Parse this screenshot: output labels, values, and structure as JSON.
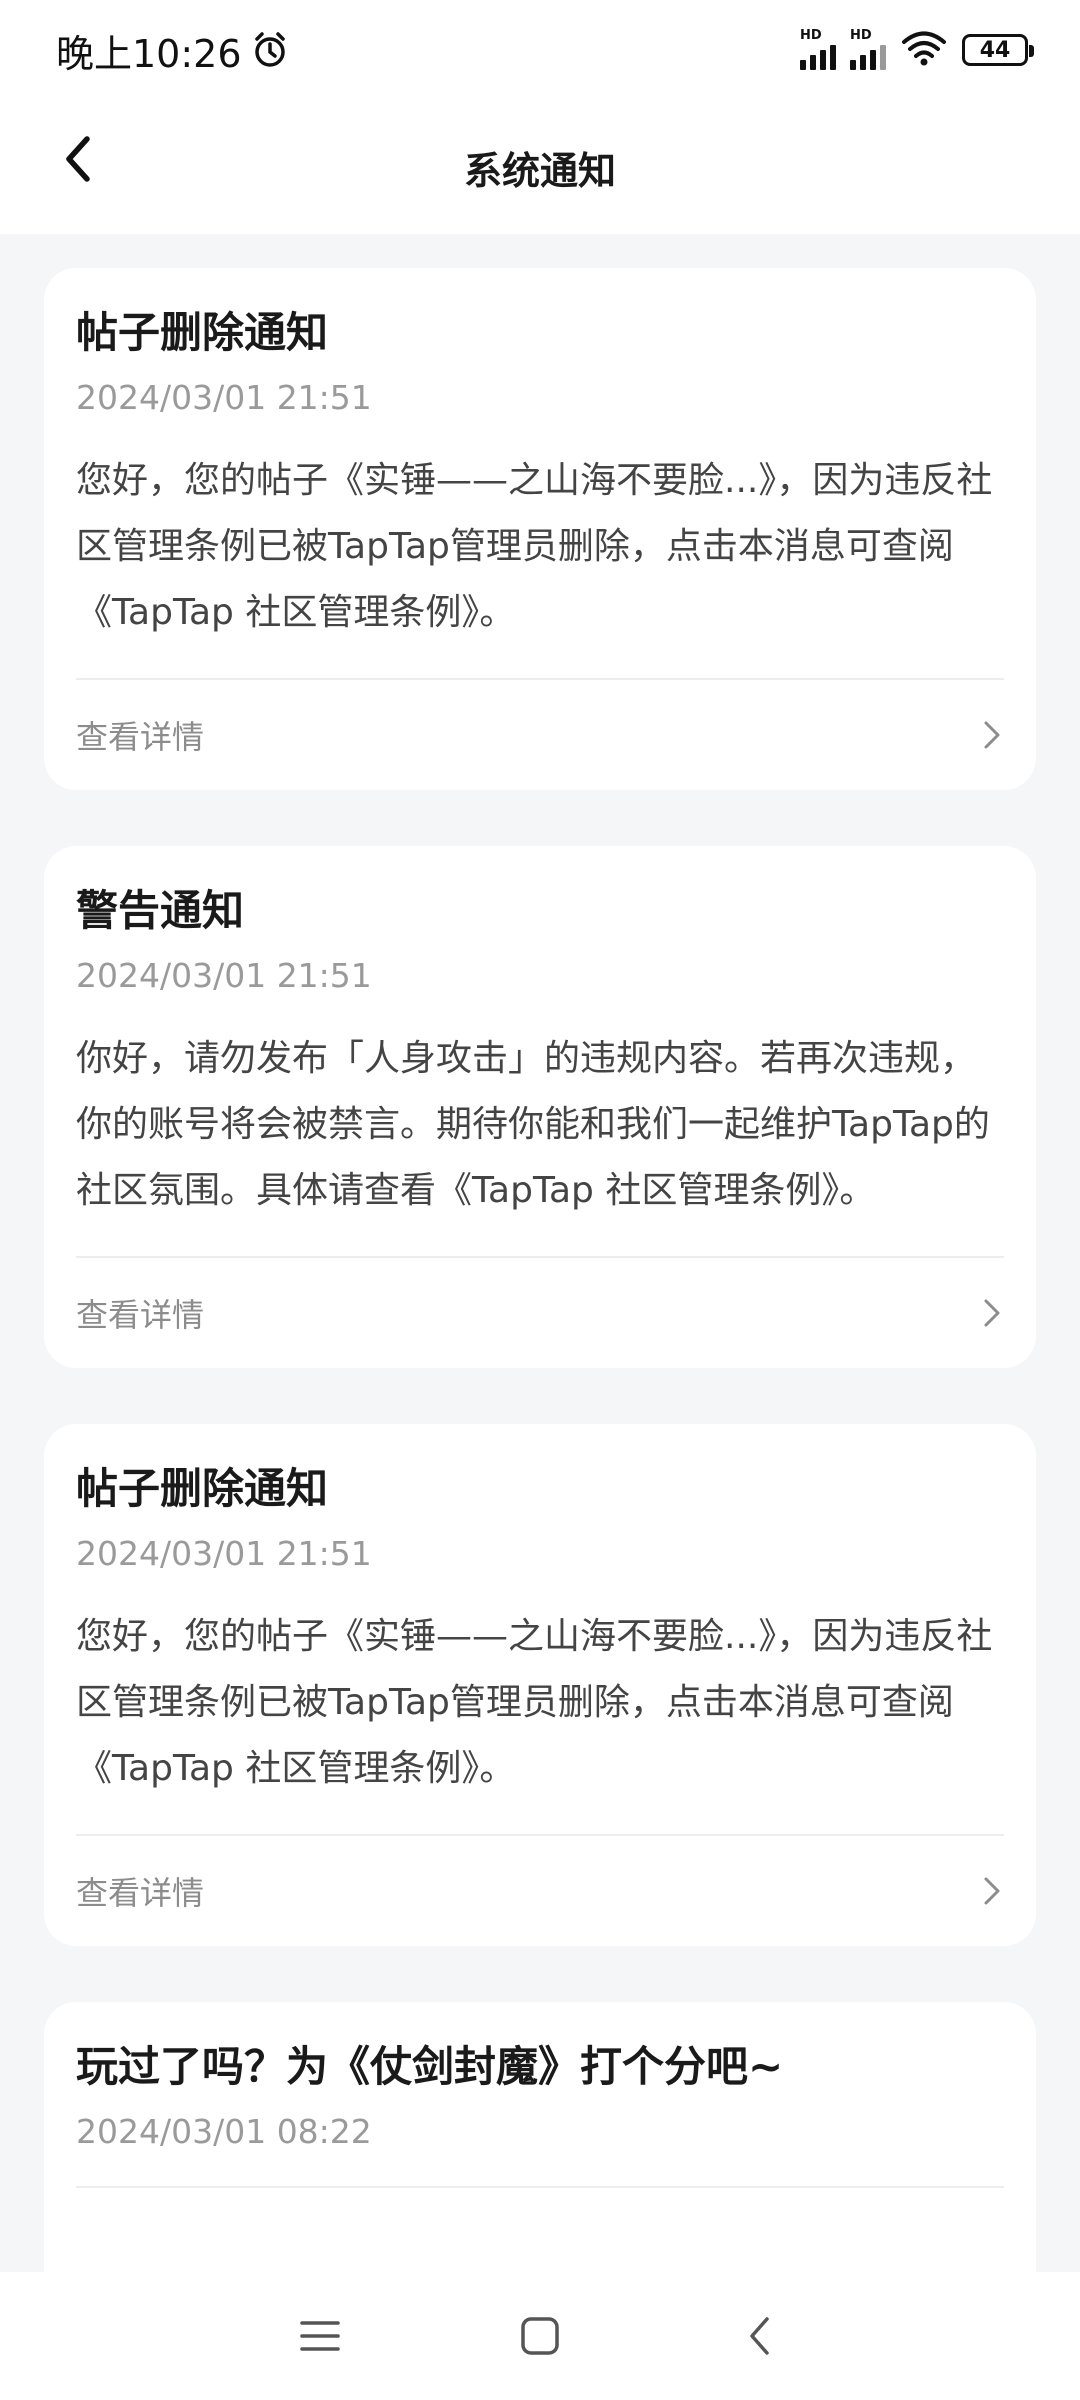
{
  "status_bar": {
    "time": "晚上10:26",
    "network_label_1": "HD",
    "network_label_2": "HD",
    "battery": "44"
  },
  "header": {
    "title": "系统通知",
    "back_icon": "chevron-left-icon"
  },
  "notifications": [
    {
      "title": "帖子删除通知",
      "time": "2024/03/01 21:51",
      "body": "您好，您的帖子《实锤——之山海不要脸...》，因为违反社区管理条例已被TapTap管理员删除，点击本消息可查阅《TapTap 社区管理条例》。",
      "detail_label": "查看详情"
    },
    {
      "title": "警告通知",
      "time": "2024/03/01 21:51",
      "body": "你好，请勿发布「人身攻击」的违规内容。若再次违规，你的账号将会被禁言。期待你能和我们一起维护TapTap的社区氛围。具体请查看《TapTap 社区管理条例》。",
      "detail_label": "查看详情"
    },
    {
      "title": "帖子删除通知",
      "time": "2024/03/01 21:51",
      "body": "您好，您的帖子《实锤——之山海不要脸...》，因为违反社区管理条例已被TapTap管理员删除，点击本消息可查阅《TapTap 社区管理条例》。",
      "detail_label": "查看详情"
    },
    {
      "title": "玩过了吗？为《仗剑封魔》打个分吧~",
      "time": "2024/03/01 08:22"
    }
  ],
  "system_nav": {
    "menu_icon": "menu-icon",
    "home_icon": "home-square-icon",
    "back_icon": "back-triangle-icon"
  },
  "colors": {
    "background": "#f5f6f8",
    "card": "#ffffff",
    "muted_text": "#9a9a9a"
  }
}
